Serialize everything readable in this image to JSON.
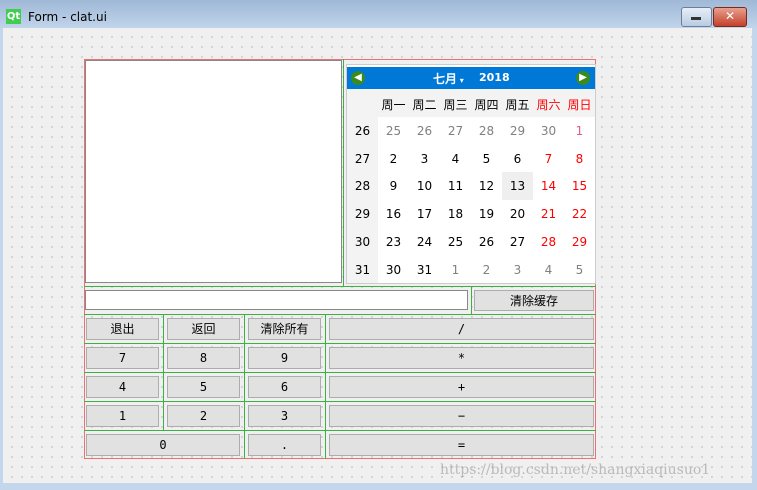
{
  "window": {
    "title": "Form - clat.ui",
    "logo": "Qt",
    "minimize_icon": "minimize-icon",
    "close_icon": "close-icon"
  },
  "calendar": {
    "month": "七月",
    "year": "2018",
    "weekdays": [
      "周一",
      "周二",
      "周三",
      "周四",
      "周五",
      "周六",
      "周日"
    ],
    "weeks": [
      {
        "num": "26",
        "days": [
          "25",
          "26",
          "27",
          "28",
          "29",
          "30",
          "1"
        ]
      },
      {
        "num": "27",
        "days": [
          "2",
          "3",
          "4",
          "5",
          "6",
          "7",
          "8"
        ]
      },
      {
        "num": "28",
        "days": [
          "9",
          "10",
          "11",
          "12",
          "13",
          "14",
          "15"
        ]
      },
      {
        "num": "29",
        "days": [
          "16",
          "17",
          "18",
          "19",
          "20",
          "21",
          "22"
        ]
      },
      {
        "num": "30",
        "days": [
          "23",
          "24",
          "25",
          "26",
          "27",
          "28",
          "29"
        ]
      },
      {
        "num": "31",
        "days": [
          "30",
          "31",
          "1",
          "2",
          "3",
          "4",
          "5"
        ]
      }
    ],
    "selected": "13",
    "colors": {
      "header": "#0078d7",
      "weekend": "#ff0000",
      "other_month": "#808080"
    }
  },
  "input": {
    "value": ""
  },
  "clear_cache": "清除缓存",
  "buttons": {
    "exit": "退出",
    "back": "返回",
    "clear_all": "清除所有",
    "div": "/",
    "n7": "7",
    "n8": "8",
    "n9": "9",
    "mul": "*",
    "n4": "4",
    "n5": "5",
    "n6": "6",
    "add": "+",
    "n1": "1",
    "n2": "2",
    "n3": "3",
    "sub": "−",
    "n0": "0",
    "dot": ".",
    "eq": "="
  },
  "watermark": "https://blog.csdn.net/shangxiaqiusuo1"
}
